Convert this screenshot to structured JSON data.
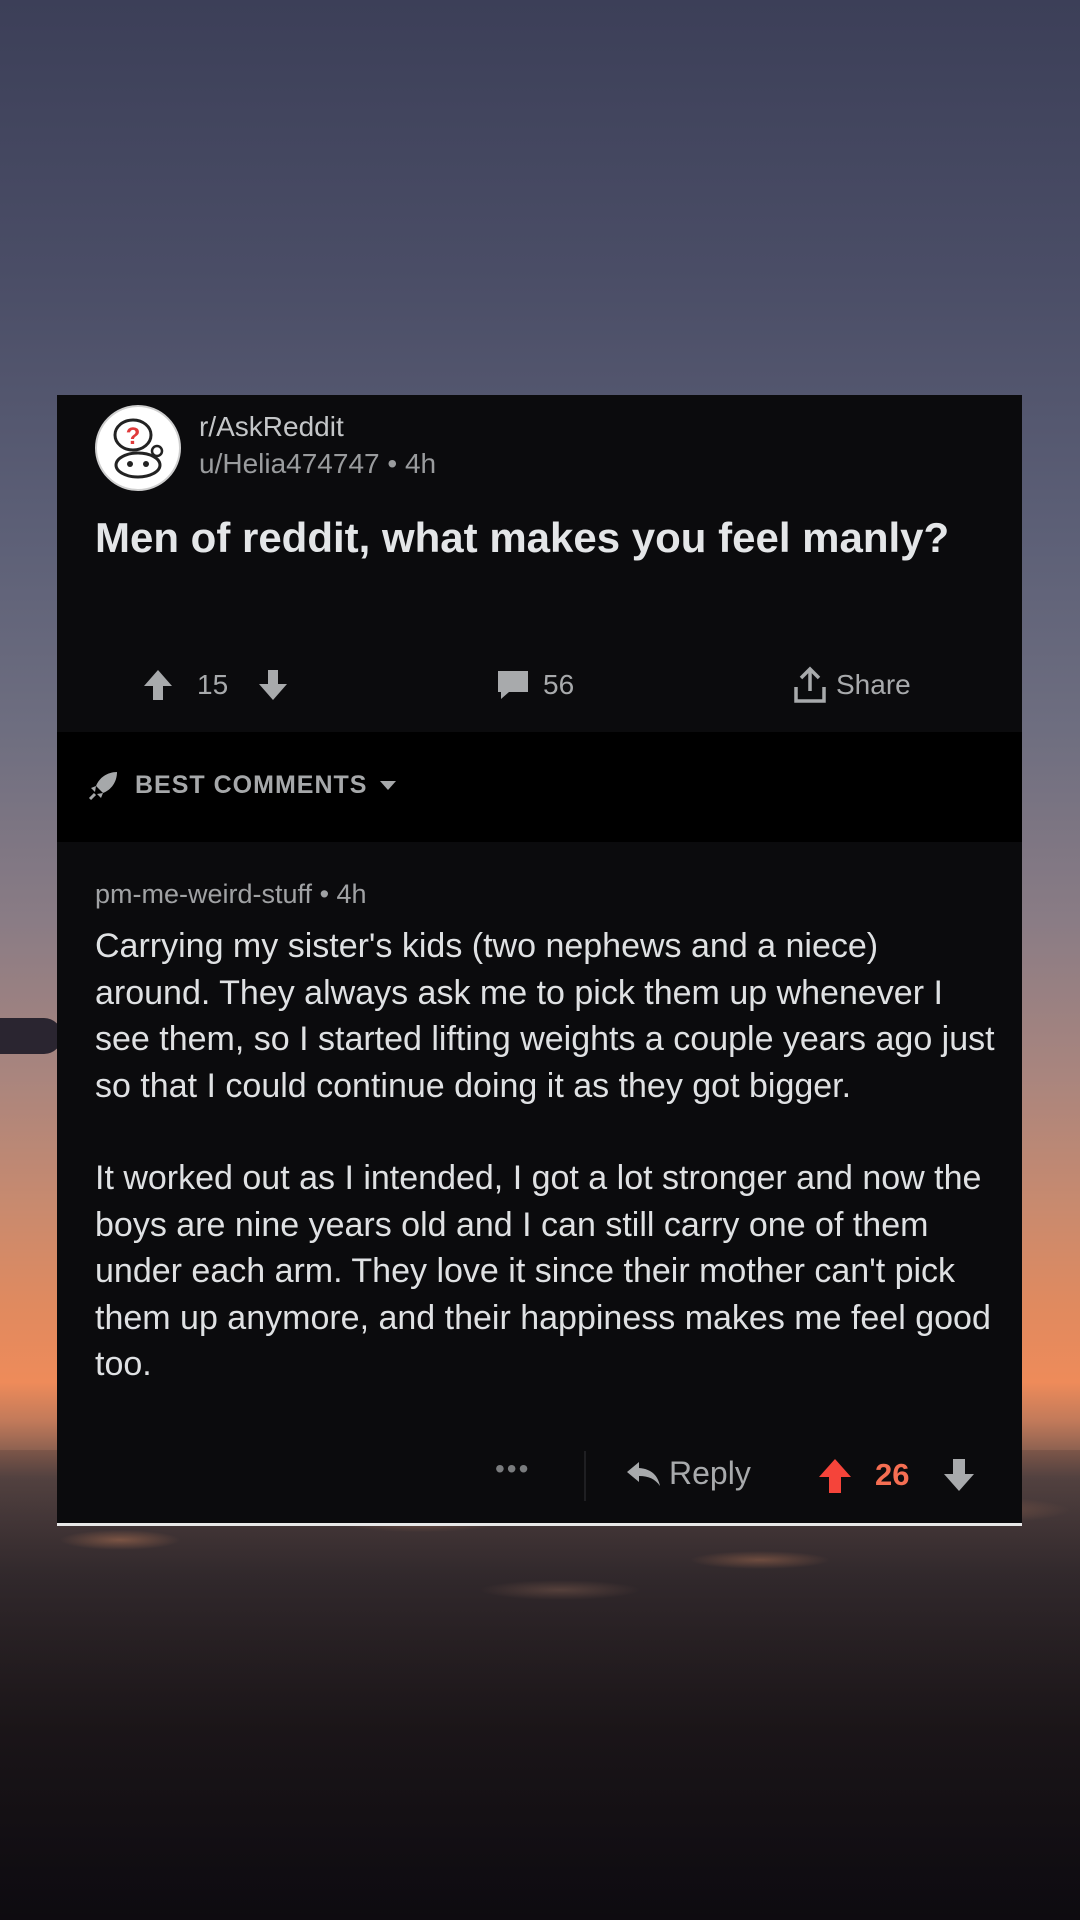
{
  "post": {
    "subreddit": "r/AskReddit",
    "author": "u/Helia474747",
    "age": "4h",
    "title": "Men of reddit, what makes you feel manly?",
    "score": "15",
    "comments_count": "56",
    "share_label": "Share"
  },
  "sort": {
    "label": "BEST COMMENTS"
  },
  "comment": {
    "author": "pm-me-weird-stuff",
    "age": "4h",
    "paragraphs": [
      "Carrying my sister's kids (two nephews and a niece) around. They always ask me to pick them up whenever I see them, so I started lifting weights a couple years ago just so that I could continue doing it as they got bigger.",
      "It worked out as I intended, I got a lot stronger and now the boys are nine years old and I can still carry one of them under each arm. They love it since their mother can't pick them up anymore, and their happiness makes me feel good too."
    ],
    "more_label": "•••",
    "reply_label": "Reply",
    "score": "26"
  },
  "colors": {
    "card_bg": "#0b0b0d",
    "upvote_active": "#f5443a",
    "score_active": "#f56e52",
    "muted": "#a8aaac"
  }
}
